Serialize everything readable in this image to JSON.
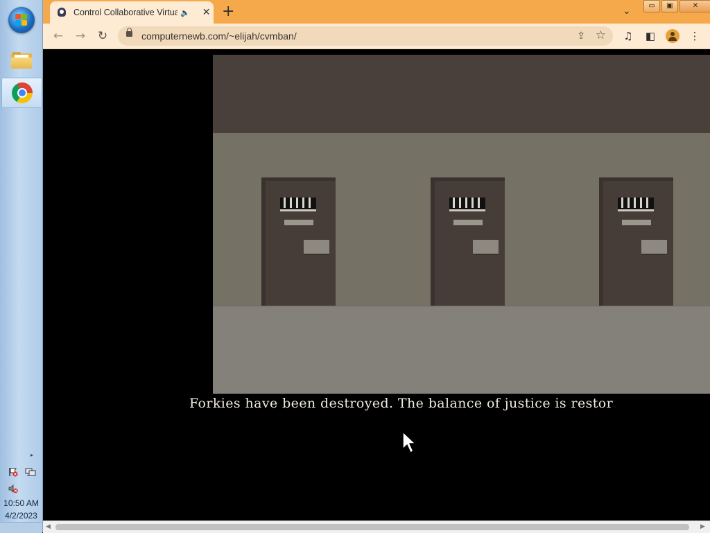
{
  "taskbar": {
    "clock_time": "10:50 AM",
    "clock_date": "4/2/2023",
    "tray_expand_glyph": "▸",
    "icons": [
      "windows-start-orb",
      "file-explorer-icon",
      "chrome-icon",
      "action-center-flag-icon",
      "network-icon",
      "volume-muted-icon"
    ]
  },
  "browser": {
    "tab_title": "Control Collaborative Virtual",
    "tab_audio_glyph": "🔈",
    "tab_close_glyph": "✕",
    "new_tab_glyph": "+",
    "tab_search_glyph": "⌄",
    "window_buttons": {
      "minimize": "▭",
      "maximize": "▣",
      "close": "✕"
    },
    "nav": {
      "back": "←",
      "forward": "→",
      "reload": "↻"
    },
    "url": "computernewb.com/~elijah/cvmban/",
    "share_glyph": "⇪",
    "bookmark_glyph": "☆",
    "toolbar_icons": {
      "media": "♫",
      "side_panel": "◧",
      "menu": "⋮"
    }
  },
  "page": {
    "dialog_text": "Forkies have been destroyed. The balance of justice is restor",
    "scene_colors": {
      "ceiling": "#49403c",
      "wall": "#767165",
      "floor": "#84817a",
      "door": "#463d38"
    },
    "door_count": 3
  },
  "scrollbar": {
    "left_arrow": "◀",
    "right_arrow": "▶"
  }
}
